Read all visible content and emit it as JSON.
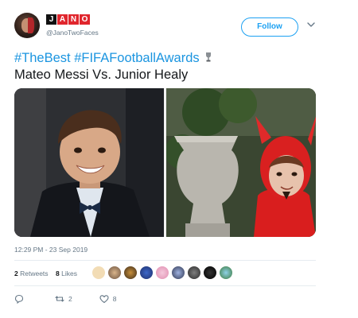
{
  "author": {
    "name_letters": [
      "J",
      "A",
      "N",
      "O"
    ],
    "handle": "@JanoTwoFaces",
    "follow_label": "Follow"
  },
  "tweet": {
    "hashtags": "#TheBest #FIFAFootballAwards",
    "text": "Mateo Messi Vs. Junior Healy",
    "timestamp": "12:29 PM - 23 Sep 2019"
  },
  "stats": {
    "retweets_count": "2",
    "retweets_label": "Retweets",
    "likes_count": "8",
    "likes_label": "Likes"
  },
  "actions": {
    "reply_count": "",
    "retweet_count": "2",
    "like_count": "8"
  },
  "colors": {
    "accent": "#1da1f2",
    "hashtag": "#1b95e0",
    "muted": "#657786",
    "brand_red": "#e0262d"
  },
  "icons": [
    "chevron-down-icon",
    "trophy-icon",
    "reply-icon",
    "retweet-icon",
    "heart-icon"
  ]
}
